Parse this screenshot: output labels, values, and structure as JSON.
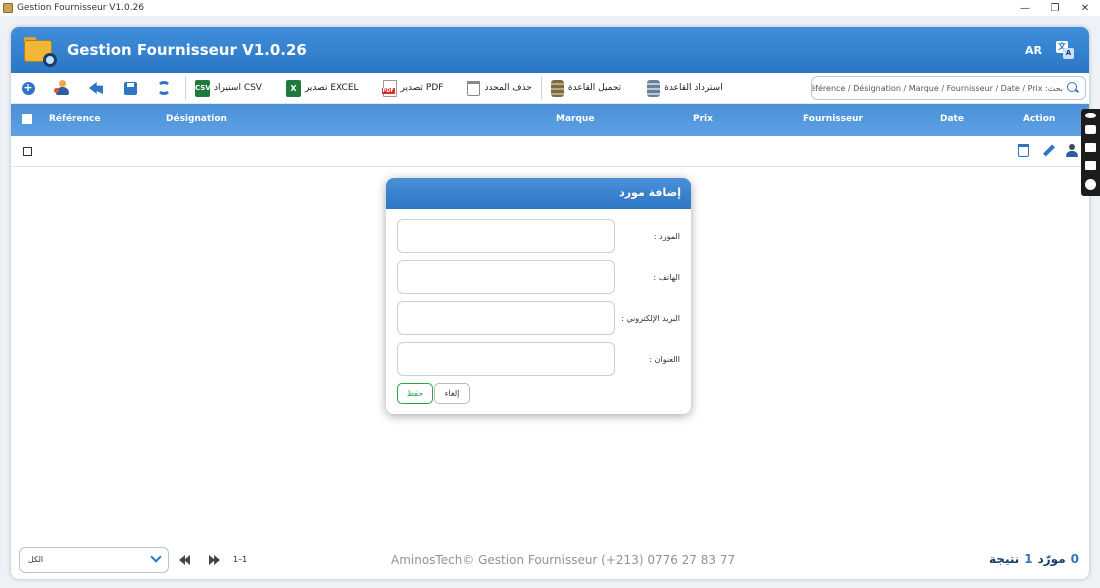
{
  "window": {
    "title": "Gestion Fournisseur V1.0.26",
    "minimize": "—",
    "restore": "❐",
    "close": "✕"
  },
  "header": {
    "title": "Gestion Fournisseur V1.0.26",
    "lang": "AR",
    "translate_a": "文",
    "translate_b": "A"
  },
  "toolbar": {
    "plus": "+",
    "csv_label": "استيراد CSV",
    "csv_badge": "CSV",
    "excel_label": "تصدير EXCEL",
    "excel_badge": "X",
    "pdf_label": "تصدير PDF",
    "delete_label": "حذف المحدد",
    "load_db_label": "تحميل القاعدة",
    "restore_db_label": "استرداد القاعدة",
    "search_placeholder": "بحث: Référence / Désignation / Marque / Fournisseur / Date / Prix"
  },
  "table": {
    "columns": [
      "Référence",
      "Désignation",
      "Marque",
      "Prix",
      "Fournisseur",
      "Date",
      "Action"
    ]
  },
  "modal": {
    "title": "إضافة مورد",
    "fields": [
      {
        "label": "المورد :",
        "value": ""
      },
      {
        "label": "الهاتف :",
        "value": ""
      },
      {
        "label": "البريد الإلكتروني :",
        "value": ""
      },
      {
        "label": "االعنوان :",
        "value": ""
      }
    ],
    "save": "حفظ",
    "cancel": "إلغاء"
  },
  "footer": {
    "page_select": "الكل",
    "page_range": "1–1",
    "copyright": "AminosTech© Gestion Fournisseur (+213) 0776 27 83 77",
    "results_count": "1",
    "results_label": "نتيجة",
    "suppliers_count": "0",
    "suppliers_label": "مورّد"
  },
  "colors": {
    "primary": "#2c76c4",
    "header_top": "#3f8fdc",
    "save_green": "#2ca24a"
  }
}
